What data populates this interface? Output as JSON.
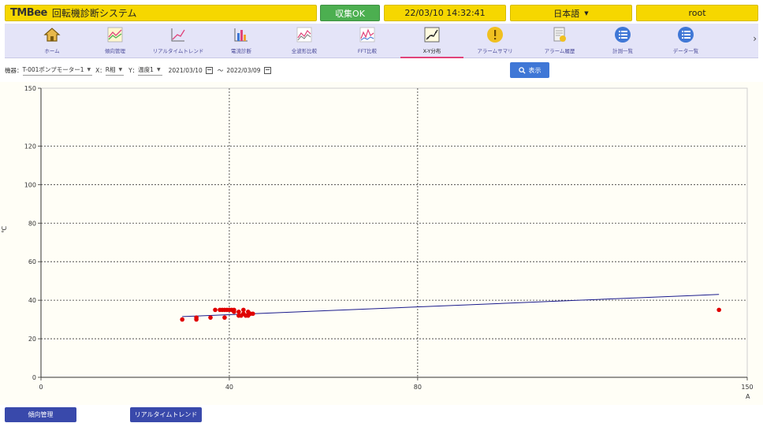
{
  "header": {
    "logo": "TMBee",
    "system_name": "回転機診断システム",
    "status": "収集OK",
    "datetime": "22/03/10 14:32:41",
    "language": "日本語",
    "user": "root"
  },
  "nav": {
    "items": [
      {
        "label": "ホーム",
        "icon": "home-icon"
      },
      {
        "label": "傾向管理",
        "icon": "trend-icon"
      },
      {
        "label": "リアルタイムトレンド",
        "icon": "realtime-trend-icon"
      },
      {
        "label": "電流診断",
        "icon": "current-diagnosis-icon"
      },
      {
        "label": "全波形比較",
        "icon": "waveform-compare-icon"
      },
      {
        "label": "FFT比較",
        "icon": "fft-compare-icon"
      },
      {
        "label": "X-Y分布",
        "icon": "xy-distribution-icon"
      },
      {
        "label": "アラームサマリ",
        "icon": "alarm-icon"
      },
      {
        "label": "アラーム履歴",
        "icon": "alarm-history-icon"
      },
      {
        "label": "計測一覧",
        "icon": "list-icon"
      },
      {
        "label": "データ一覧",
        "icon": "list-icon"
      }
    ],
    "active_index": 6
  },
  "filters": {
    "device_label": "機器：",
    "device_value": "T-001ポンプモーター1",
    "x_label": "X：",
    "x_value": "R相",
    "y_label": "Y：",
    "y_value": "温度1",
    "date_from": "2021/03/10",
    "separator": "～",
    "date_to": "2022/03/09",
    "show_button": "表示"
  },
  "colors": {
    "accent_yellow": "#f6d700",
    "status_green": "#4caf50",
    "nav_bg": "#e4e4f8",
    "point_red": "#e00000",
    "line_blue": "#1a1a8c",
    "button_blue": "#3f77d6",
    "bottom_button": "#3949ab"
  },
  "chart_data": {
    "type": "scatter",
    "xlabel": "A",
    "ylabel": "℃",
    "xlim": [
      0,
      150
    ],
    "ylim": [
      0,
      150
    ],
    "x_ticks": [
      0,
      40,
      80,
      150
    ],
    "y_ticks": [
      0,
      20,
      40,
      60,
      80,
      100,
      120,
      150
    ],
    "grid": true,
    "points": [
      [
        30,
        30
      ],
      [
        33,
        30
      ],
      [
        33,
        31
      ],
      [
        36,
        31
      ],
      [
        37,
        35
      ],
      [
        38,
        35
      ],
      [
        38.5,
        35
      ],
      [
        39,
        31
      ],
      [
        39,
        35
      ],
      [
        39.5,
        35
      ],
      [
        40,
        35
      ],
      [
        40.5,
        35
      ],
      [
        41,
        34
      ],
      [
        41,
        35
      ],
      [
        42,
        32
      ],
      [
        42,
        34
      ],
      [
        42.5,
        32
      ],
      [
        43,
        33
      ],
      [
        43,
        35
      ],
      [
        43.5,
        32
      ],
      [
        44,
        32
      ],
      [
        44,
        34
      ],
      [
        44.5,
        33
      ],
      [
        45,
        33
      ],
      [
        144,
        35
      ]
    ],
    "trendline": [
      [
        30,
        31.5
      ],
      [
        144,
        43
      ]
    ]
  },
  "bottom": {
    "button1": "傾向管理",
    "button2": "リアルタイムトレンド"
  }
}
